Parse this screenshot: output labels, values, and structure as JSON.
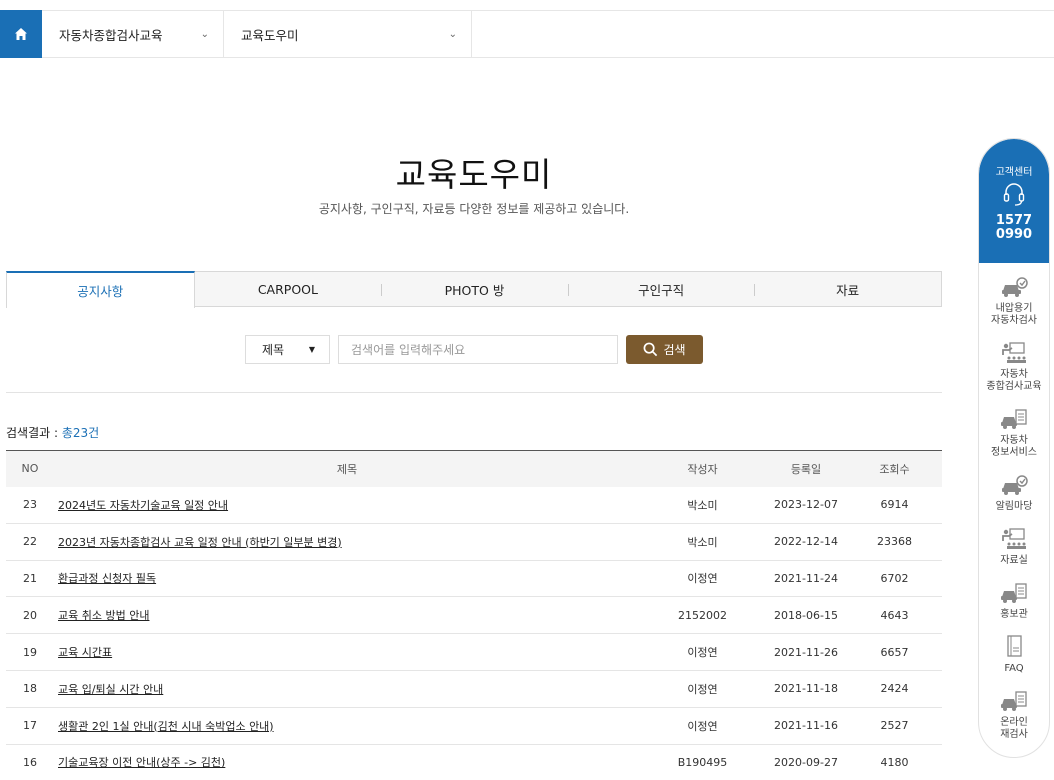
{
  "nav": {
    "home_icon": "home-icon",
    "select1": "자동차종합검사교육",
    "select2": "교육도우미"
  },
  "page": {
    "title": "교육도우미",
    "subtitle": "공지사항, 구인구직, 자료등 다양한 정보를 제공하고 있습니다."
  },
  "tabs": [
    "공지사항",
    "CARPOOL",
    "PHOTO 방",
    "구인구직",
    "자료"
  ],
  "search": {
    "field": "제목",
    "placeholder": "검색어를 입력해주세요",
    "button": "검색"
  },
  "result": {
    "label": "검색결과 : ",
    "count": "총23건"
  },
  "table": {
    "headers": {
      "no": "NO",
      "title": "제목",
      "author": "작성자",
      "date": "등록일",
      "views": "조회수"
    },
    "rows": [
      {
        "no": "23",
        "title": "2024년도 자동차기술교육 일정 안내",
        "author": "박소미",
        "date": "2023-12-07",
        "views": "6914"
      },
      {
        "no": "22",
        "title": "2023년 자동차종합검사 교육 일정 안내 (하반기 일부분 변경)",
        "author": "박소미",
        "date": "2022-12-14",
        "views": "23368"
      },
      {
        "no": "21",
        "title": "환급과정 신청자 필독",
        "author": "이정연",
        "date": "2021-11-24",
        "views": "6702"
      },
      {
        "no": "20",
        "title": "교육 취소 방법 안내",
        "author": "2152002",
        "date": "2018-06-15",
        "views": "4643"
      },
      {
        "no": "19",
        "title": "교육 시간표",
        "author": "이정연",
        "date": "2021-11-26",
        "views": "6657"
      },
      {
        "no": "18",
        "title": "교육 입/퇴실 시간 안내",
        "author": "이정연",
        "date": "2021-11-18",
        "views": "2424"
      },
      {
        "no": "17",
        "title": "생활관 2인 1실 안내(김천 시내 숙박업소 안내)",
        "author": "이정연",
        "date": "2021-11-16",
        "views": "2527"
      },
      {
        "no": "16",
        "title": "기술교육장 이전 안내(상주 -> 김천)",
        "author": "B190495",
        "date": "2020-09-27",
        "views": "4180"
      }
    ]
  },
  "quick": {
    "head_label": "고객센터",
    "phone1": "1577",
    "phone2": "0990",
    "items": [
      {
        "line1": "내압용기",
        "line2": "자동차검사",
        "icon": "car-check-icon"
      },
      {
        "line1": "자동차",
        "line2": "종합검사교육",
        "icon": "lecture-icon"
      },
      {
        "line1": "자동차",
        "line2": "정보서비스",
        "icon": "car-info-icon"
      },
      {
        "line1": "알림마당",
        "line2": "",
        "icon": "car-check-icon"
      },
      {
        "line1": "자료실",
        "line2": "",
        "icon": "lecture-icon"
      },
      {
        "line1": "홍보관",
        "line2": "",
        "icon": "car-info-icon"
      },
      {
        "line1": "FAQ",
        "line2": "",
        "icon": "notebook-icon"
      },
      {
        "line1": "온라인",
        "line2": "재검사",
        "icon": "car-info-icon"
      }
    ]
  }
}
